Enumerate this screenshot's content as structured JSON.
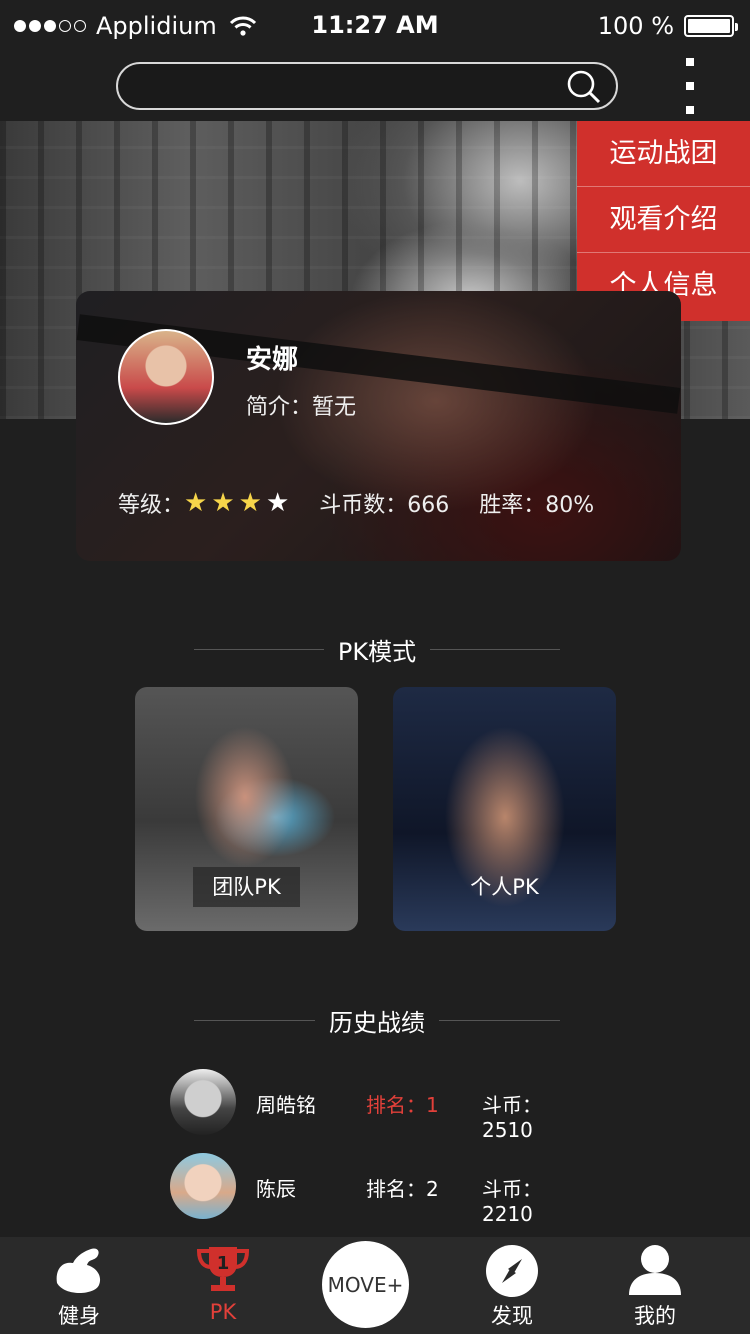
{
  "status_bar": {
    "carrier": "Applidium",
    "time": "11:27 AM",
    "battery": "100 %"
  },
  "search": {
    "value": "",
    "placeholder": ""
  },
  "menu": {
    "items": [
      {
        "label": "运动战团"
      },
      {
        "label": "观看介绍"
      },
      {
        "label": "个人信息"
      }
    ]
  },
  "profile": {
    "name": "安娜",
    "intro": "简介：暂无",
    "level_label": "等级：",
    "level_stars": {
      "filled": 3,
      "total": 4
    },
    "coins": "斗币数：666",
    "win_rate": "胜率：80%"
  },
  "pk_section": {
    "title": "PK模式",
    "modes": [
      {
        "label": "团队PK"
      },
      {
        "label": "个人PK"
      }
    ]
  },
  "history": {
    "title": "历史战绩",
    "rows": [
      {
        "name": "周皓铭",
        "rank": "排名：1",
        "coins": "斗币：2510"
      },
      {
        "name": "陈辰",
        "rank": "排名：2",
        "coins": "斗币：2210"
      }
    ]
  },
  "tabbar": {
    "items": [
      {
        "label": "健身",
        "icon": "muscle-icon"
      },
      {
        "label": "PK",
        "icon": "trophy-icon",
        "active": true
      },
      {
        "label": "MOVE+"
      },
      {
        "label": "发现",
        "icon": "compass-icon"
      },
      {
        "label": "我的",
        "icon": "user-icon"
      }
    ],
    "trophy_number": "1"
  },
  "colors": {
    "accent": "#e2403a",
    "menu_bg": "#d0302c",
    "background": "#1f1f1f",
    "star": "#f6d54a"
  }
}
